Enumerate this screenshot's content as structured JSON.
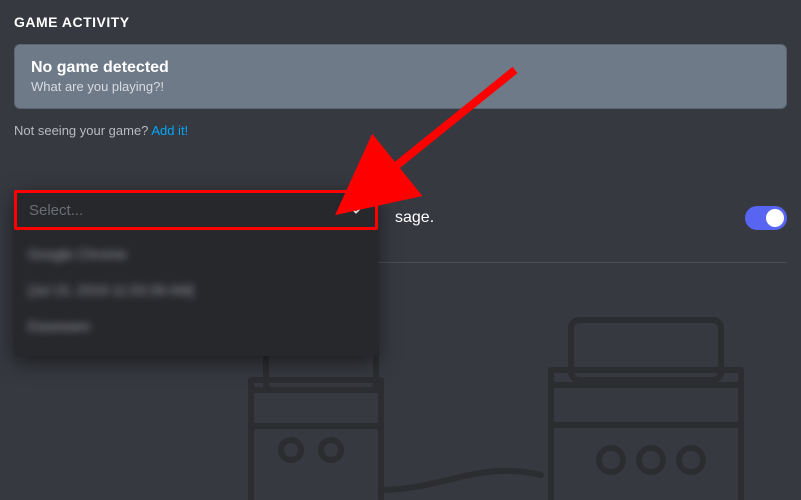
{
  "header": {
    "title": "GAME ACTIVITY"
  },
  "card": {
    "title": "No game detected",
    "subtitle": "What are you playing?!"
  },
  "helper": {
    "prefix": "Not seeing your game? ",
    "link": "Add it!"
  },
  "status": {
    "tail": "sage.",
    "toggle_on": true
  },
  "dropdown": {
    "placeholder": "Select...",
    "options": [
      {
        "label": "Google Chrome",
        "blurred": true
      },
      {
        "label": "[Jul 15, 2019 11:53:39 AM]",
        "blurred": true
      },
      {
        "label": "Easeware",
        "blurred": true
      }
    ]
  },
  "colors": {
    "accent": "#5865f2",
    "link": "#00a8fc",
    "annotation": "#ff0000",
    "bg": "#36393f",
    "panel": "#26282c"
  }
}
